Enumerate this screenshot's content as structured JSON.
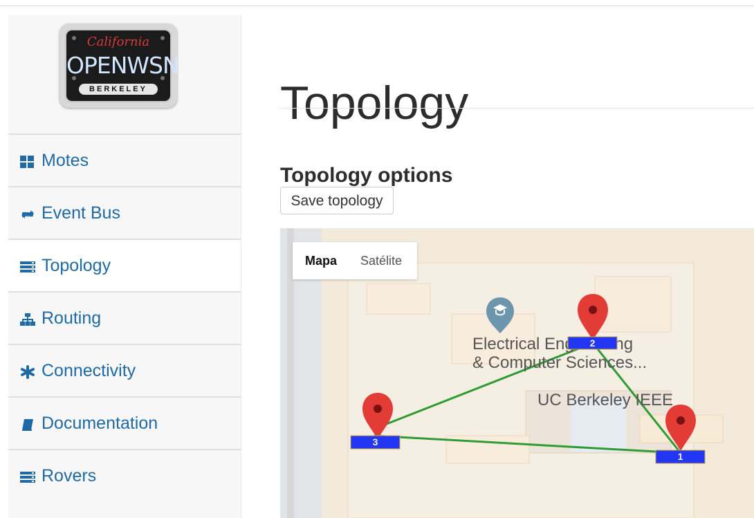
{
  "sidebar": {
    "logo": {
      "top_text": "California",
      "main_text": "OPENWSN",
      "bottom_text": "BERKELEY"
    },
    "items": [
      {
        "label": "Motes",
        "icon": "grid-icon"
      },
      {
        "label": "Event Bus",
        "icon": "retweet-icon"
      },
      {
        "label": "Topology",
        "icon": "stack-icon"
      },
      {
        "label": "Routing",
        "icon": "sitemap-icon"
      },
      {
        "label": "Connectivity",
        "icon": "asterisk-icon"
      },
      {
        "label": "Documentation",
        "icon": "book-icon"
      },
      {
        "label": "Rovers",
        "icon": "stack-icon"
      }
    ]
  },
  "header": {
    "title": "Topology"
  },
  "main": {
    "section_title": "Topology options",
    "save_button_label": "Save topology",
    "map": {
      "tabs": [
        "Mapa",
        "Satélite"
      ],
      "place_label_line1": "Electrical Engineering",
      "place_label_line2": "& Computer Sciences...",
      "secondary_label": "UC Berkeley IEEE",
      "nodes": [
        "1",
        "2",
        "3"
      ],
      "link_color": "#2e9b33",
      "node_color": "#2336f2",
      "marker_color": "#e33b35"
    }
  },
  "colors": {
    "sidebar_link": "#1f6aa5",
    "map_background": "#f3eadb"
  }
}
